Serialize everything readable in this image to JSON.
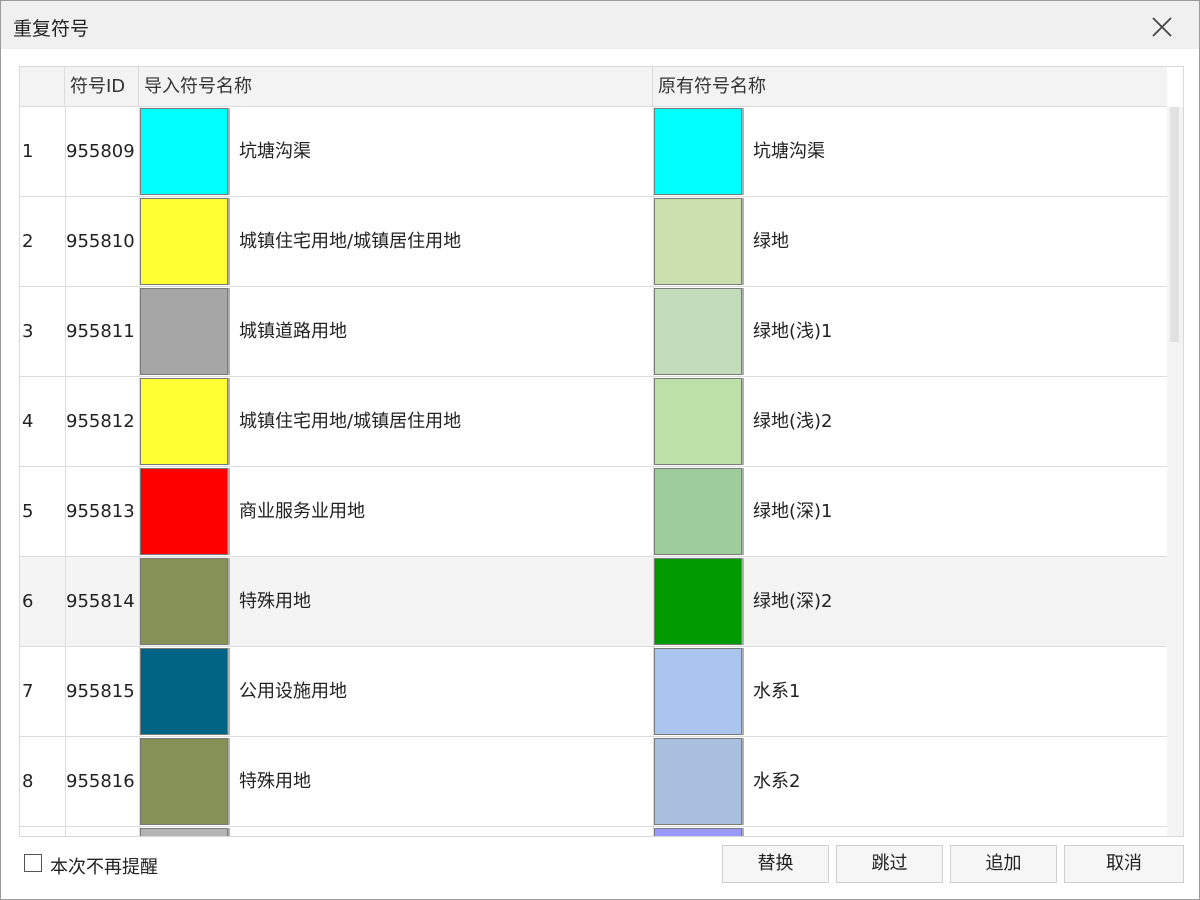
{
  "dialog": {
    "title": "重复符号",
    "close_icon": "close-icon"
  },
  "table": {
    "columns": [
      "",
      "符号ID",
      "导入符号名称",
      "原有符号名称"
    ],
    "rows": [
      {
        "index": "1",
        "id": "955809",
        "import_color": "#00FFFF",
        "import_name": "坑塘沟渠",
        "orig_color": "#00FFFF",
        "orig_name": "坑塘沟渠"
      },
      {
        "index": "2",
        "id": "955810",
        "import_color": "#FFFF33",
        "import_name": "城镇住宅用地/城镇居住用地",
        "orig_color": "#CCE0AF",
        "orig_name": "绿地"
      },
      {
        "index": "3",
        "id": "955811",
        "import_color": "#A6A6A6",
        "import_name": "城镇道路用地",
        "orig_color": "#C3DDBC",
        "orig_name": "绿地(浅)1"
      },
      {
        "index": "4",
        "id": "955812",
        "import_color": "#FFFF33",
        "import_name": "城镇住宅用地/城镇居住用地",
        "orig_color": "#BDE0A8",
        "orig_name": "绿地(浅)2"
      },
      {
        "index": "5",
        "id": "955813",
        "import_color": "#FF0000",
        "import_name": "商业服务业用地",
        "orig_color": "#9CCD9A",
        "orig_name": "绿地(深)1"
      },
      {
        "index": "6",
        "id": "955814",
        "import_color": "#869158",
        "import_name": "特殊用地",
        "orig_color": "#009900",
        "orig_name": "绿地(深)2"
      },
      {
        "index": "7",
        "id": "955815",
        "import_color": "#006484",
        "import_name": "公用设施用地",
        "orig_color": "#AAC6EE",
        "orig_name": "水系1"
      },
      {
        "index": "8",
        "id": "955816",
        "import_color": "#869158",
        "import_name": "特殊用地",
        "orig_color": "#A8C0DE",
        "orig_name": "水系2"
      },
      {
        "index": "",
        "id": "",
        "import_color": "#B4B4B4",
        "import_name": "",
        "orig_color": "#9999FF",
        "orig_name": ""
      }
    ],
    "selected_row": 5
  },
  "footer": {
    "checkbox_label": "本次不再提醒",
    "checkbox_checked": false,
    "buttons": [
      "替换",
      "跳过",
      "追加",
      "取消"
    ]
  }
}
